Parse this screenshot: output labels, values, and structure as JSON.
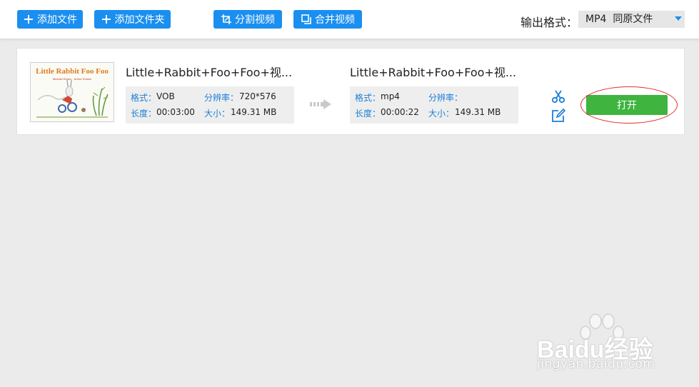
{
  "toolbar": {
    "add_file": "添加文件",
    "add_folder": "添加文件夹",
    "split_video": "分割视频",
    "merge_video": "合并视频",
    "output_format_label": "输出格式：",
    "output_format_value": "MP4  同原文件"
  },
  "item": {
    "thumbnail": {
      "title": "Little Rabbit Foo Foo",
      "authors_line": "Michael Rosen  ·  Arthur Robins"
    },
    "source": {
      "filename": "Little+Rabbit+Foo+Foo+视...",
      "format_label": "格式：",
      "format_value": "VOB",
      "resolution_label": "分辨率：",
      "resolution_value": "720*576",
      "duration_label": "长度：",
      "duration_value": "00:03:00",
      "size_label": "大小：",
      "size_value": "149.31 MB"
    },
    "target": {
      "filename": "Little+Rabbit+Foo+Foo+视...",
      "format_label": "格式：",
      "format_value": "mp4",
      "resolution_label": "分辨率：",
      "resolution_value": "",
      "duration_label": "长度：",
      "duration_value": "00:00:22",
      "size_label": "大小：",
      "size_value": "149.31 MB"
    },
    "open_button": "打开"
  },
  "watermark": {
    "brand": "Baidu经验",
    "url": "jingyan.baidu.com"
  },
  "colors": {
    "accent_blue": "#1a8ff0",
    "open_green": "#3fb43f",
    "annotation_red": "#e03030",
    "background": "#ebebeb"
  },
  "icons": [
    "plus-icon",
    "crop-icon",
    "merge-icon",
    "dropdown-caret-icon",
    "arrow-right-icon",
    "scissors-icon",
    "edit-icon"
  ]
}
